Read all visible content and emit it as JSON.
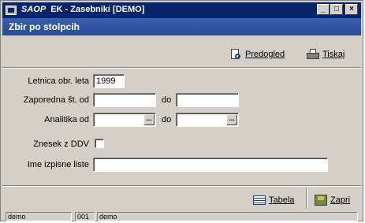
{
  "window": {
    "brand": "SAOP",
    "title": "EK - Zasebniki [DEMO]",
    "controls": {
      "minimize": "_",
      "maximize": "□",
      "close": "×"
    }
  },
  "subheader": {
    "title": "Zbir po stolpcih"
  },
  "toolbar": {
    "preview_label": "Predogled",
    "preview_icon": "preview-icon",
    "print_label": "Tiskaj",
    "print_icon": "printer-icon"
  },
  "form": {
    "year_label": "Letnica obr. leta",
    "year_value": "1999",
    "seq_from_label": "Zaporedna št. od",
    "seq_from_value": "",
    "seq_to_label": "do",
    "seq_to_value": "",
    "analytics_from_label": "Analitika od",
    "analytics_from_value": "",
    "analytics_to_label": "do",
    "analytics_to_value": "",
    "lookup_label": "...",
    "vat_label": "Znesek z DDV",
    "vat_checked": false,
    "print_name_label": "Ime izpisne liste",
    "print_name_value": ""
  },
  "footer": {
    "table_label": "Tabela",
    "table_icon": "table-icon",
    "close_label": "Zapri",
    "close_icon": "close-door-icon"
  },
  "statusbar": {
    "user": "demo",
    "code": "001",
    "company": "demo"
  }
}
